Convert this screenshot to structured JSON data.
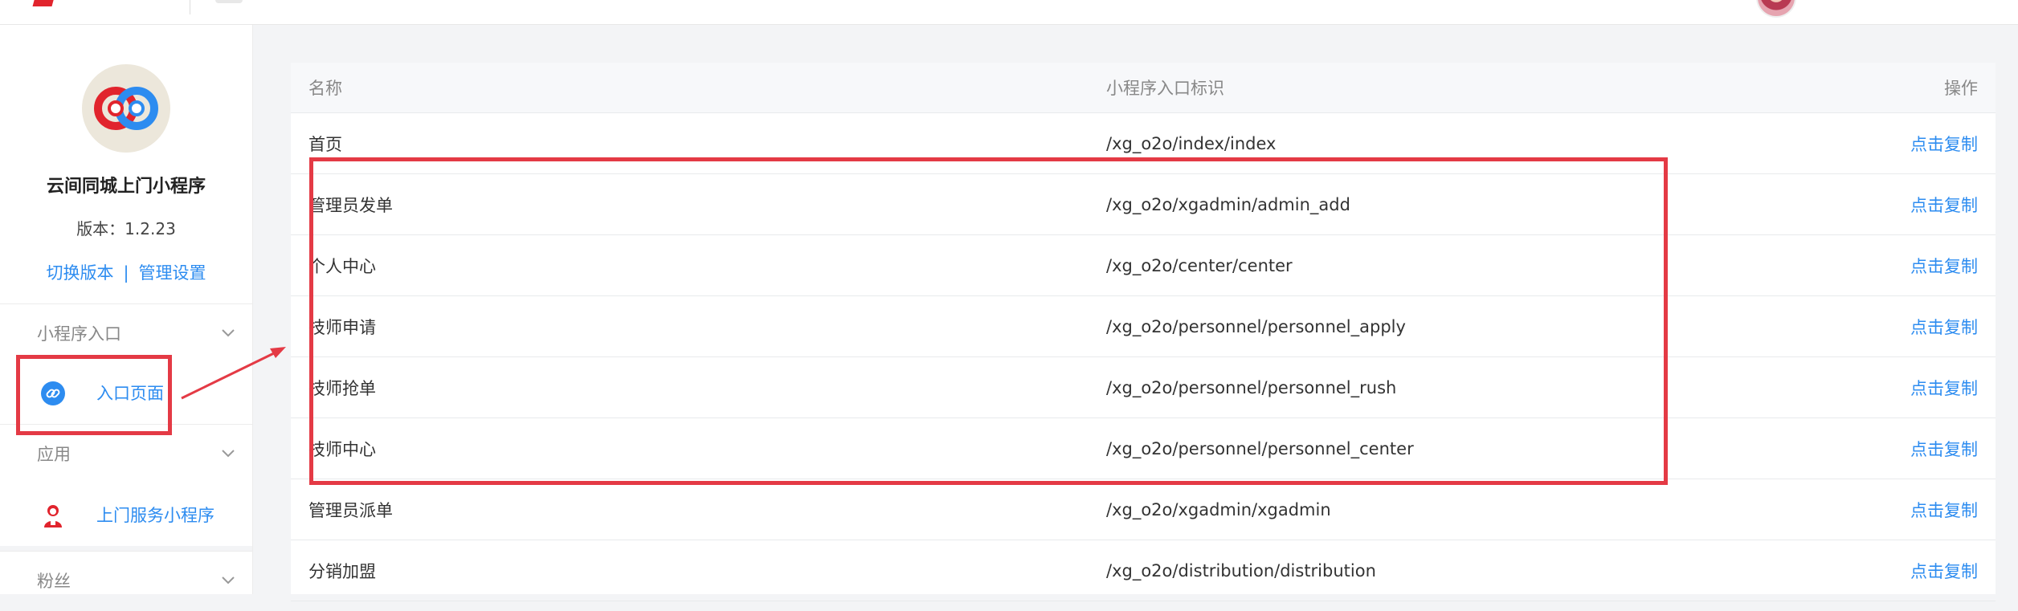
{
  "topbar": {
    "brand_logo": "brand-logo"
  },
  "sidebar": {
    "app_name": "云间同城上门小程序",
    "version": "版本：1.2.23",
    "switch_version": "切换版本",
    "separator": "|",
    "manage_settings": "管理设置",
    "sections": [
      {
        "label": "小程序入口",
        "items": [
          {
            "label": "入口页面",
            "icon": "link-icon",
            "active": true
          }
        ]
      },
      {
        "label": "应用",
        "items": [
          {
            "label": "上门服务小程序",
            "icon": "service-person-icon"
          }
        ]
      },
      {
        "label": "粉丝",
        "items": []
      }
    ]
  },
  "table": {
    "headers": [
      "名称",
      "小程序入口标识",
      "操作"
    ],
    "rows": [
      {
        "name": "首页",
        "path": "/xg_o2o/index/index",
        "action": "点击复制"
      },
      {
        "name": "管理员发单",
        "path": "/xg_o2o/xgadmin/admin_add",
        "action": "点击复制"
      },
      {
        "name": "个人中心",
        "path": "/xg_o2o/center/center",
        "action": "点击复制"
      },
      {
        "name": "技师申请",
        "path": "/xg_o2o/personnel/personnel_apply",
        "action": "点击复制"
      },
      {
        "name": "技师抢单",
        "path": "/xg_o2o/personnel/personnel_rush",
        "action": "点击复制"
      },
      {
        "name": "技师中心",
        "path": "/xg_o2o/personnel/personnel_center",
        "action": "点击复制"
      },
      {
        "name": "管理员派单",
        "path": "/xg_o2o/xgadmin/xgadmin",
        "action": "点击复制"
      },
      {
        "name": "分销加盟",
        "path": "/xg_o2o/distribution/distribution",
        "action": "点击复制"
      }
    ]
  },
  "colors": {
    "accent": "#2d8cf0",
    "annotation": "#e43a45",
    "logo_red": "#e1242d"
  }
}
